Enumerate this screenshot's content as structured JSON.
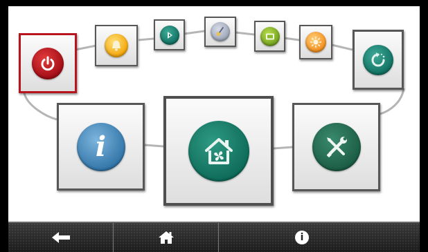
{
  "screen": {
    "background": "#ffffff",
    "connector_color": "#b5b5b5"
  },
  "top_row": {
    "power": {
      "icon": "power-icon",
      "color": "#b8141e"
    },
    "alarm": {
      "icon": "bell-icon",
      "color": "#f3a60a"
    },
    "boost": {
      "icon": "boost-icon",
      "color": "#0e6e5f"
    },
    "clean": {
      "icon": "broom-icon",
      "color": "#99a2b4"
    },
    "filter": {
      "icon": "filter-icon",
      "color": "#6f9e1a"
    },
    "brightness": {
      "icon": "sun-icon",
      "color": "#f28b18"
    },
    "refresh": {
      "icon": "refresh-icon",
      "color": "#0e6e5f"
    }
  },
  "main_row": {
    "info": {
      "icon": "info-icon",
      "glyph": "i",
      "color": "#2f73a6"
    },
    "home_ventilation": {
      "icon": "house-fan-icon",
      "color": "#0d6a58"
    },
    "settings": {
      "icon": "wrench-screwdriver-icon",
      "color": "#1a5b43"
    }
  },
  "bottom_bar": {
    "back": {
      "icon": "back-arrow-icon"
    },
    "home": {
      "icon": "home-icon"
    },
    "info": {
      "icon": "info-circle-icon",
      "glyph": "i"
    }
  }
}
